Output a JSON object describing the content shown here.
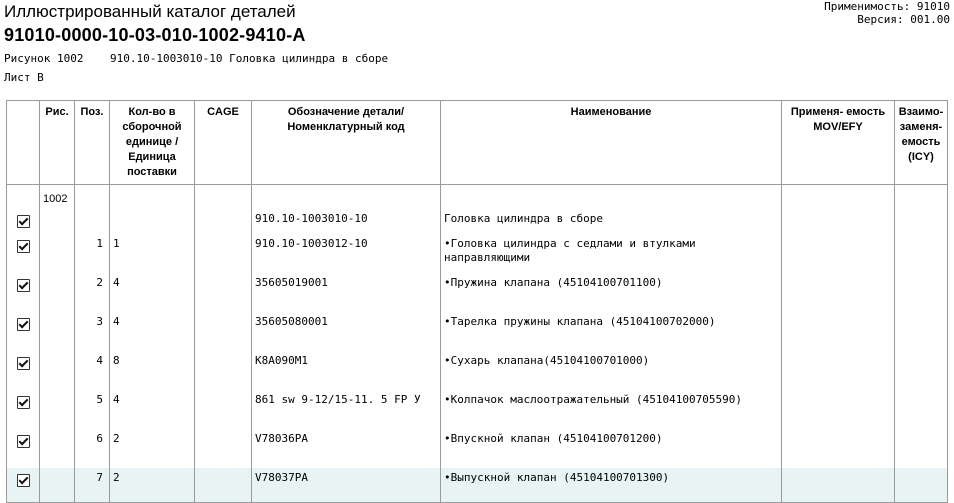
{
  "header": {
    "title": "Иллюстрированный каталог деталей",
    "doc_code": "91010-0000-10-03-010-1002-9410-A",
    "applicability_label": "Применимость:",
    "applicability_value": "91010",
    "version_label": "Версия:",
    "version_value": "001.00",
    "figure_line": "Рисунок 1002    910.10-1003010-10 Головка цилиндра в сборе",
    "sheet_line": "Лист B"
  },
  "table": {
    "columns": {
      "fig": "Рис.",
      "pos": "Поз.",
      "qty": "Кол-во в сборочной единице /Единица поставки",
      "cage": "CAGE",
      "part": "Обозначение детали/ Номенклатурный код",
      "name": "Наименование",
      "mov": "Применя- емость MOV/EFY",
      "icy": "Взаимо- заменя- емость (ICY)"
    },
    "figure_number": "1002",
    "rows": [
      {
        "checked": true,
        "pos": "",
        "qty": "",
        "part": "910.10-1003010-10",
        "name": "Головка цилиндра в сборе"
      },
      {
        "checked": true,
        "pos": "1",
        "qty": "1",
        "part": "910.10-1003012-10",
        "name": "•Головка цилиндра с седлами и втулками направляющими"
      },
      {
        "checked": true,
        "pos": "2",
        "qty": "4",
        "part": "35605019001",
        "name": "•Пружина клапана (45104100701100)"
      },
      {
        "checked": true,
        "pos": "3",
        "qty": "4",
        "part": "35605080001",
        "name": "•Тарелка пружины клапана (45104100702000)"
      },
      {
        "checked": true,
        "pos": "4",
        "qty": "8",
        "part": "K8A090M1",
        "name": "•Сухарь клапана(45104100701000)"
      },
      {
        "checked": true,
        "pos": "5",
        "qty": "4",
        "part": "861 sw 9-12/15-11. 5 FP У",
        "name": "•Колпачок маслоотражательный (45104100705590)"
      },
      {
        "checked": true,
        "pos": "6",
        "qty": "2",
        "part": "V78036PA",
        "name": "•Впускной клапан (45104100701200)"
      },
      {
        "checked": true,
        "pos": "7",
        "qty": "2",
        "part": "V78037PA",
        "name": "•Выпускной клапан (45104100701300)"
      }
    ]
  }
}
